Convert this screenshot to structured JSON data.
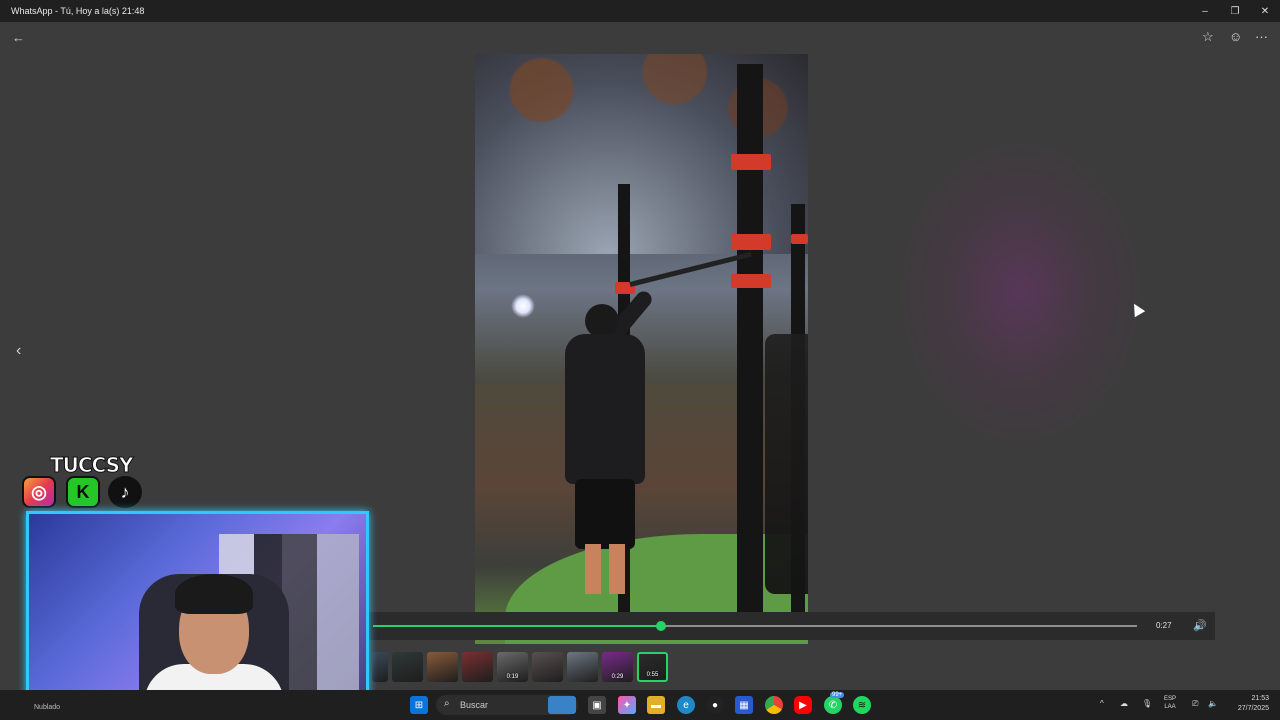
{
  "window": {
    "title": "WhatsApp - Tú, Hoy a la(s) 21:48",
    "controls": {
      "minimize": "–",
      "maximize": "❐",
      "close": "✕"
    }
  },
  "viewer": {
    "back_icon": "←",
    "star_icon": "☆",
    "emoji_icon": "☺",
    "more_icon": "···",
    "prev_icon": "‹"
  },
  "player": {
    "progress_fraction": 0.377,
    "time": "0:27",
    "volume_icon": "🔊",
    "accent": "#25d366"
  },
  "thumbnails": [
    {
      "label": "",
      "color": "#3a4a5a",
      "selected": false
    },
    {
      "label": "",
      "color": "#2f3838",
      "selected": false
    },
    {
      "label": "",
      "color": "#8a5a3a",
      "selected": false
    },
    {
      "label": "",
      "color": "#7a3030",
      "selected": false
    },
    {
      "label": "0:19",
      "color": "#6a6a6a",
      "selected": false
    },
    {
      "label": "",
      "color": "#5a5050",
      "selected": false
    },
    {
      "label": "",
      "color": "#6e7782",
      "selected": false
    },
    {
      "label": "0:29",
      "color": "#7a2a8a",
      "selected": false
    },
    {
      "label": "0:55",
      "color": "#2a2a2a",
      "selected": true
    }
  ],
  "overlay": {
    "brand": "TUCCSY",
    "instagram_glyph": "◎",
    "kick_glyph": "K",
    "tiktok_glyph": "♪"
  },
  "taskbar": {
    "weather": "Nublado",
    "search_placeholder": "Buscar",
    "search_icon": "⌕",
    "whatsapp_badge": "99+",
    "lang_line1": "ESP",
    "lang_line2": "LAA",
    "time": "21:53",
    "date": "27/7/2025",
    "tray_up_icon": "^"
  }
}
